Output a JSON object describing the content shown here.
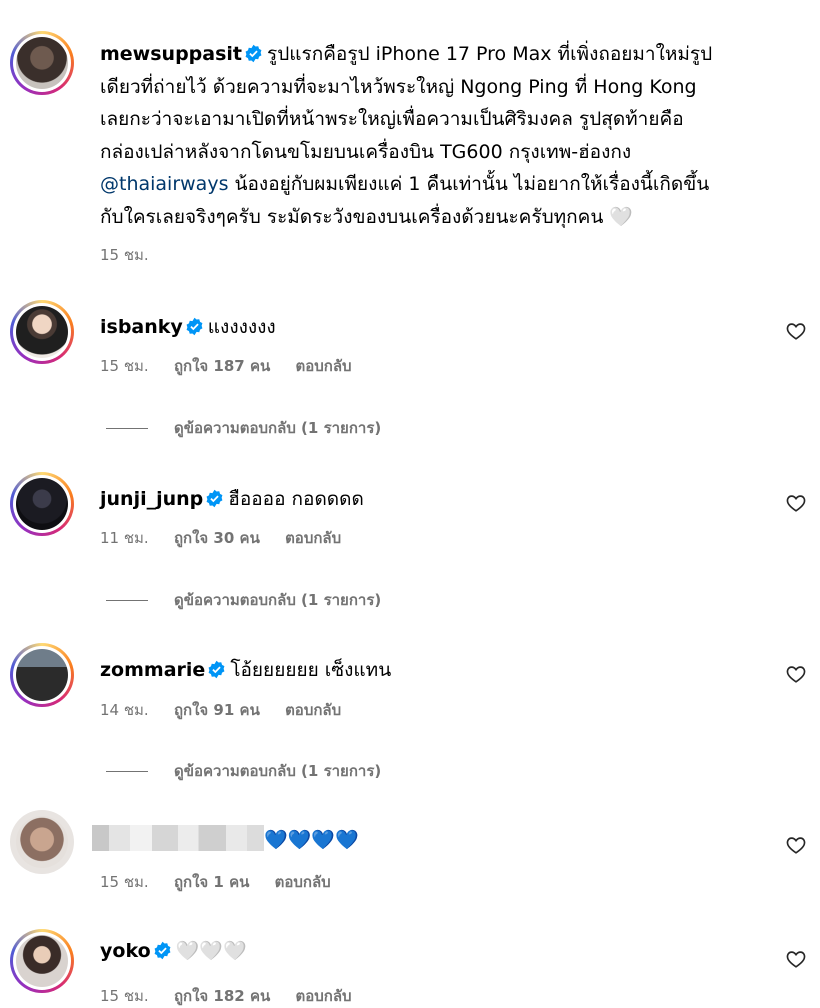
{
  "post": {
    "username": "mewsuppasit",
    "caption_lines": [
      "รูปแรกคือรูป iPhone 17 Pro Max ที่เพิ่งถอยมาใหม่รูป",
      "เดียวที่ถ่ายไว้ ด้วยความที่จะมาไหว้พระใหญ่ Ngong Ping ที่ Hong Kong",
      "เลยกะว่าจะเอามาเปิดที่หน้าพระใหญ่เพื่อความเป็นศิริมงคล รูปสุดท้ายคือ",
      "กล่องเปล่าหลังจากโดนขโมยบนเครื่องบิน TG600 กรุงเทพ-ฮ่องกง"
    ],
    "mention": "@thaiairways",
    "caption_after_mention": " น้องอยู่กับผมเพียงแค่ 1 คืนเท่านั้น ไม่อยากให้เรื่องนี้เกิดขึ้น",
    "caption_last_line": "กับใครเลยจริงๆครับ ระมัดระวังของบนเครื่องด้วยนะครับทุกคน 🤍",
    "time": "15 ชม."
  },
  "comments": [
    {
      "username": "isbanky",
      "text": "แงงงงงง",
      "time": "15 ชม.",
      "likes": "ถูกใจ 187 คน",
      "reply": "ตอบกลับ",
      "view_replies": "ดูข้อความตอบกลับ (1 รายการ)"
    },
    {
      "username": "junji_junp",
      "text": "ฮืออออ กอดดดด",
      "time": "11 ชม.",
      "likes": "ถูกใจ 30 คน",
      "reply": "ตอบกลับ",
      "view_replies": "ดูข้อความตอบกลับ (1 รายการ)"
    },
    {
      "username": "zommarie",
      "text": "โอ้ยยยยยย เซ็งแทน",
      "time": "14 ชม.",
      "likes": "ถูกใจ 91 คน",
      "reply": "ตอบกลับ",
      "view_replies": "ดูข้อความตอบกลับ (1 รายการ)"
    },
    {
      "text": "💙💙💙💙",
      "time": "15 ชม.",
      "likes": "ถูกใจ 1 คน",
      "reply": "ตอบกลับ"
    },
    {
      "username": "yoko",
      "text": "🤍🤍🤍",
      "time": "15 ชม.",
      "likes": "ถูกใจ 182 คน",
      "reply": "ตอบกลับ"
    }
  ],
  "colors": {
    "verified": "#0095f6",
    "meta": "#737373",
    "mention": "#00376b"
  },
  "icons": {
    "verified": "verified-badge-icon",
    "like": "heart-outline-icon"
  }
}
